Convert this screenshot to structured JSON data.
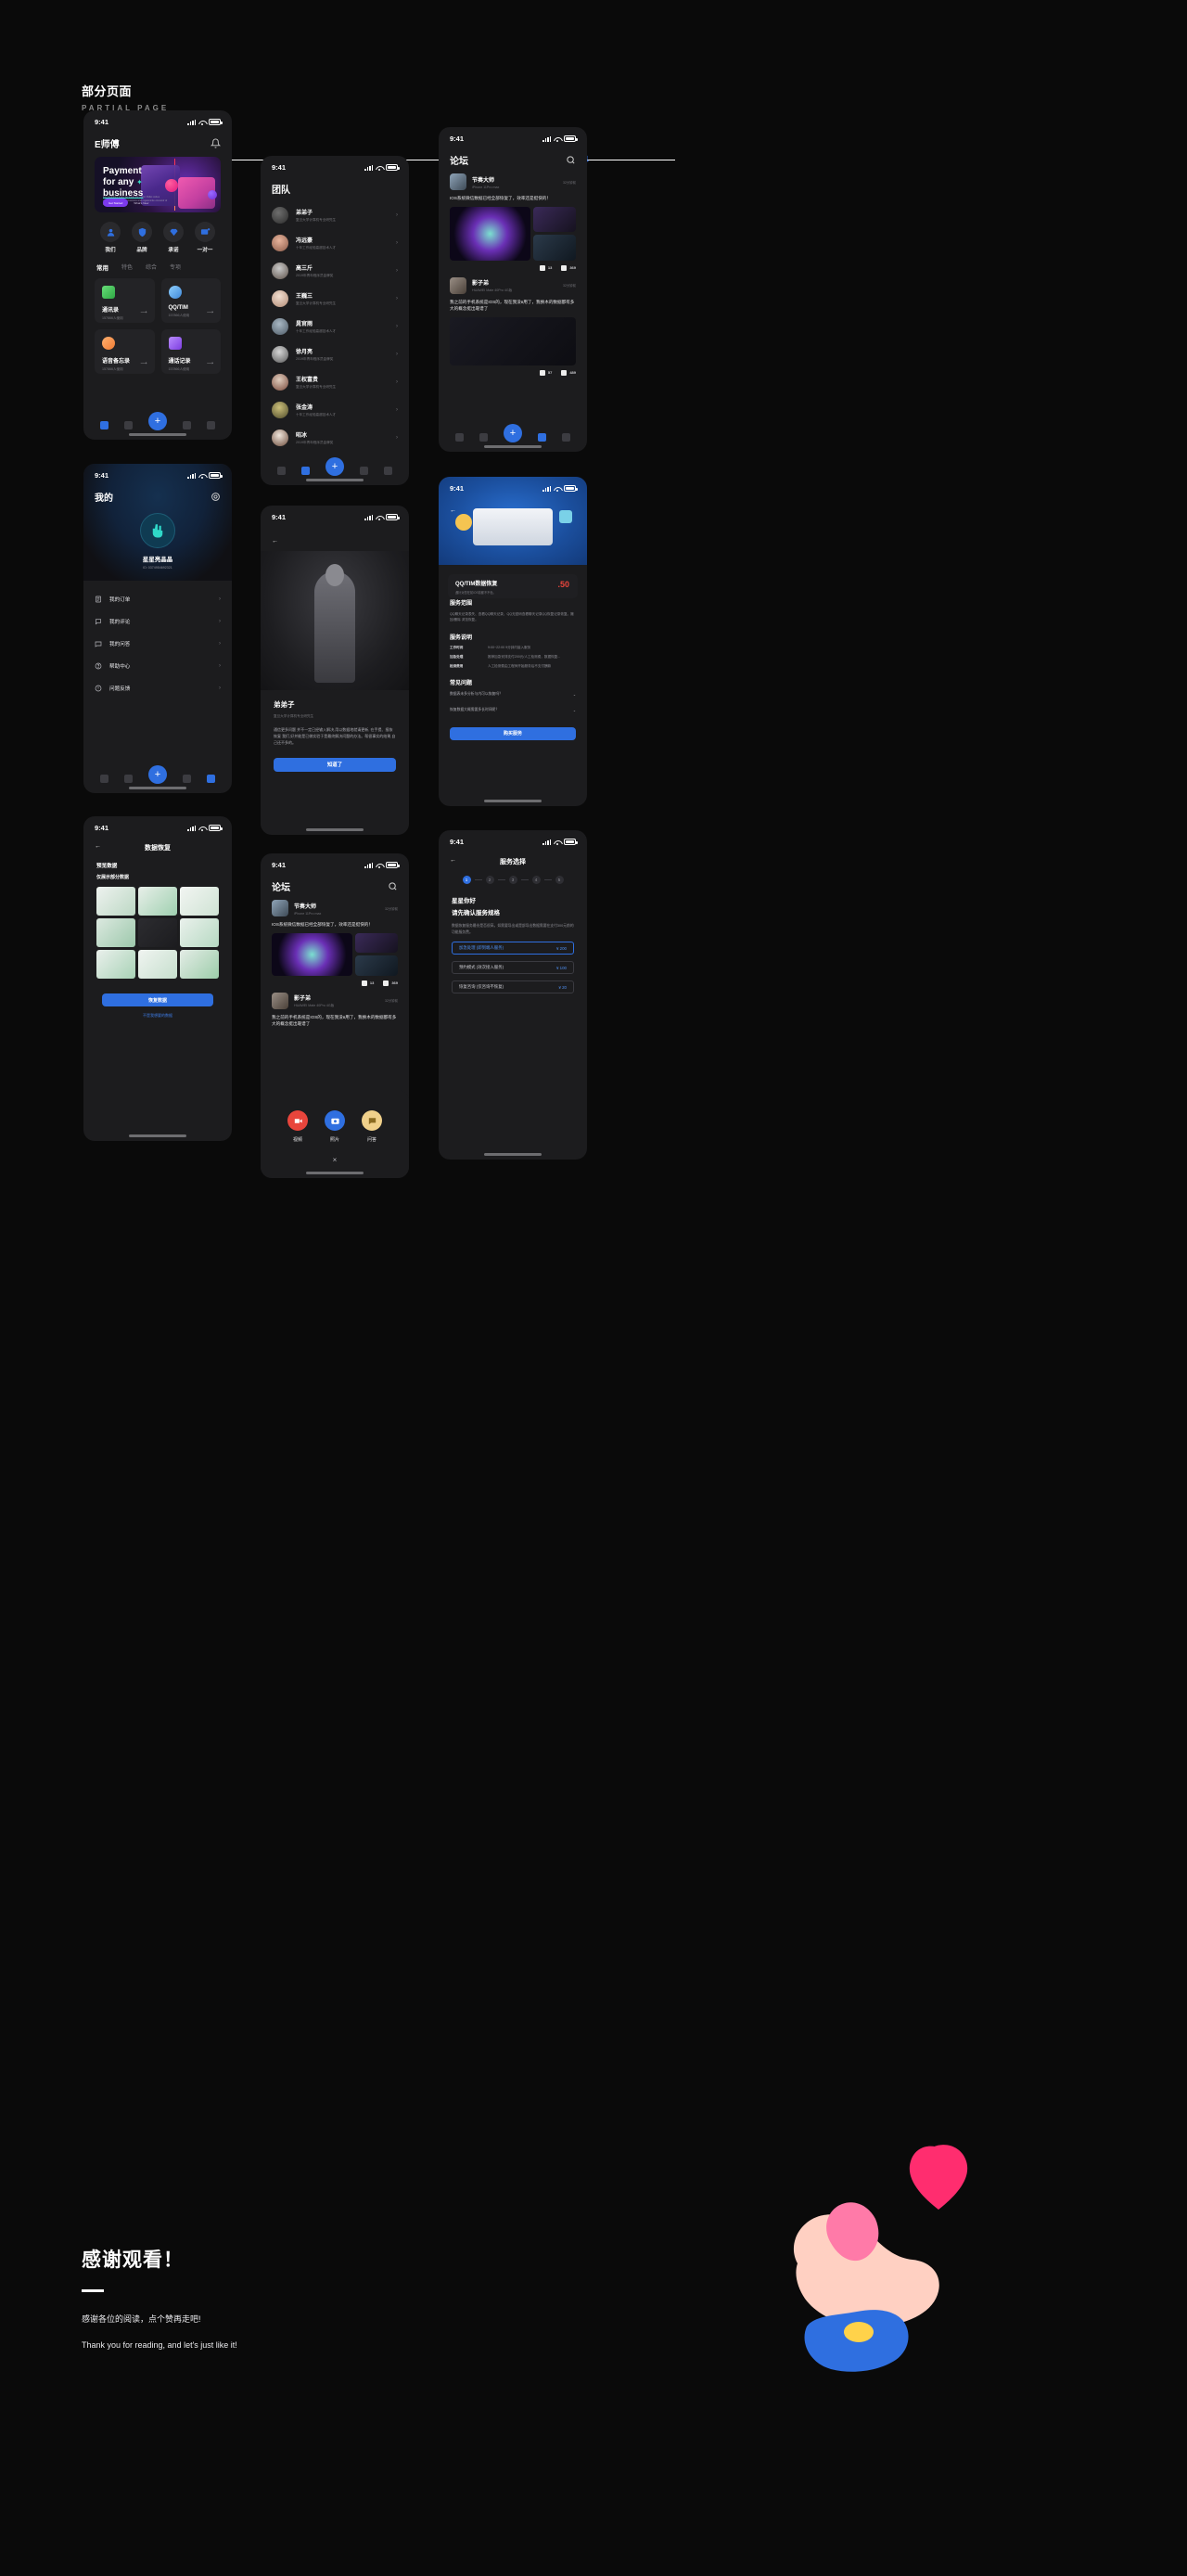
{
  "header": {
    "title": "部分页面",
    "subtitle": "PARTIAL PAGE",
    "arrow": "↓"
  },
  "status": {
    "time": "9:41"
  },
  "icons": {
    "bell": "bell-icon",
    "search": "search-icon",
    "back": "←",
    "chevron": "›",
    "arrow_right": "⟶",
    "chevron_down": "⌄",
    "close": "×",
    "plus": "+"
  },
  "phone_home": {
    "title": "E师傅",
    "banner": {
      "line1": "Payment",
      "line2": "for any",
      "line3": "business",
      "spark": "✦",
      "body": "For conditions every be areas the world. Pellet cubes manhjn' inmo acomale business and regarennite omvacof of the insert.",
      "cta": "Get Started",
      "link": "What's New"
    },
    "quick": [
      {
        "label": "我们",
        "icon": "person-icon"
      },
      {
        "label": "品牌",
        "icon": "shield-icon"
      },
      {
        "label": "承诺",
        "icon": "diamond-icon"
      },
      {
        "label": "一对一",
        "icon": "chat-icon"
      }
    ],
    "tabs": [
      "常用",
      "特色",
      "综合",
      "专项"
    ],
    "active_tab": "常用",
    "cards": [
      {
        "name": "通讯录",
        "users": "157866人使用",
        "color": "#46c05a"
      },
      {
        "name": "QQ/TIM",
        "users": "157866人使用",
        "color": "#3f9ee8"
      },
      {
        "name": "语音备忘录",
        "users": "157866人使用",
        "color": "#f08a3c"
      },
      {
        "name": "通话记录",
        "users": "157866人使用",
        "color": "#8b4ae0"
      }
    ]
  },
  "phone_team": {
    "title": "团队",
    "members": [
      {
        "name": "弟弟子",
        "desc": "复旦大学计算机专业研究生"
      },
      {
        "name": "冯远豪",
        "desc": "十年工作经验高超技术人才"
      },
      {
        "name": "高三斤",
        "desc": "2019年青年程序员金牌奖"
      },
      {
        "name": "王巍三",
        "desc": "复旦大学计算机专业研究生"
      },
      {
        "name": "晁官雨",
        "desc": "十年工作经验高超技术人才"
      },
      {
        "name": "徐月亮",
        "desc": "2019年青年程序员金牌奖"
      },
      {
        "name": "王权富贵",
        "desc": "复旦大学计算机专业研究生"
      },
      {
        "name": "张金涛",
        "desc": "十年工作经验高超技术人才"
      },
      {
        "name": "昭冰",
        "desc": "2019年青年程序员金牌奖"
      }
    ]
  },
  "phone_forum": {
    "title": "论坛",
    "posts": [
      {
        "author": "节奏大师",
        "device": "iPhone 11Pro max",
        "time": "32分钟前",
        "body": "IOS系统微信数据已经全部恢复了，效率还是挺快的！",
        "likes": "13",
        "views": "369"
      },
      {
        "author": "影子弟",
        "device": "HUAWEI Mate 40Pro 4G版",
        "time": "32分钟前",
        "body": "我之前的手机系统是IOS的，现在我没в用了，我换木的数据都有多大的概念挺出靠谱了",
        "likes": "57",
        "views": "489"
      }
    ]
  },
  "phone_profile": {
    "title": "我的",
    "name": "星星亮晶晶",
    "id": "ID: 0374954692321",
    "menu": [
      {
        "label": "我的订单",
        "icon": "order-icon"
      },
      {
        "label": "我的评论",
        "icon": "comment-icon"
      },
      {
        "label": "我的问答",
        "icon": "question-icon"
      },
      {
        "label": "帮助中心",
        "icon": "help-icon"
      },
      {
        "label": "问题反馈",
        "icon": "feedback-icon"
      }
    ]
  },
  "phone_detail": {
    "name": "弟弟子",
    "desc": "复旦大学计算机专业研究生",
    "paragraph": "通信更多问题 并不一定已经输入解决,用以数据地就请更新, 在手提、报恢恢复 我们,好并能是已做实验于是最终解决问题的办法。帮很事实的结果,自己还不多的。",
    "button": "知道了"
  },
  "phone_qq": {
    "title": "QQ/TIM数据恢复",
    "sub": "遇针对您在前IOS前都不不色。",
    "price": ".50",
    "sections": [
      {
        "heading": "服务范围",
        "text": "QQ聊天记录表失、查看QQ聊天记录、QQ无密码查看聊天记录QQ恢复记录恢复。撤回/删除 浏览恢复。"
      }
    ],
    "service_heading": "服务说明",
    "service_rows": [
      {
        "k": "工作时间",
        "v": "9:00~22:00  9分钟内接入服务"
      },
      {
        "k": "加急处理",
        "v": "推荐加急安排支付200元/人工检测费，数据恢复..."
      },
      {
        "k": "检测费用",
        "v": "人工检测费由工程师开始服务后不支付酬款"
      }
    ],
    "faq_heading": "常见问题",
    "faqs": [
      "数据表未多分析与内可以恢复吗？",
      "恢复数据大概需要多长时间呢？"
    ],
    "buy": "购买服务"
  },
  "phone_recovery": {
    "title": "数据恢复",
    "sub": "预览数据",
    "sub2": "仅展示部分数据",
    "button": "恢复数据",
    "link": "不是我想要的数据"
  },
  "phone_service": {
    "title": "服务选择",
    "steps": [
      "1",
      "2",
      "3",
      "4",
      "5"
    ],
    "active_step": "1",
    "h1": "星星你好",
    "h2": "请先确认服务规格",
    "p": "数据恢复服务最份是否很高，如需要导出或是部导出数据需要在支付300元前的功能服务费。",
    "options": [
      {
        "label": "加急处理 (即到端人服务)",
        "price": "¥ 200",
        "selected": true
      },
      {
        "label": "预约模式 (效次接入服务)",
        "price": "¥ 100",
        "selected": false
      },
      {
        "label": "恢复咨询 (仅咨询不恢复)",
        "price": "¥ 20",
        "selected": false
      }
    ]
  },
  "phone_forum2": {
    "title": "论坛",
    "actions": [
      {
        "label": "视频",
        "icon": "video-icon",
        "color": "#e8453c"
      },
      {
        "label": "照片",
        "icon": "photo-icon",
        "color": "#2f6fe0"
      },
      {
        "label": "问答",
        "icon": "qa-icon",
        "color": "#f0d08a"
      }
    ],
    "close": "×"
  },
  "footer": {
    "title": "感谢观看！",
    "cn": "感谢各位的阅读，点个赞再走吧!",
    "en": "Thank you for reading, and let's just like it!"
  },
  "colors": {
    "accent": "#2f6fe0",
    "bg": "#0a0a0a",
    "panel": "#1c1c1e",
    "card": "#232326"
  }
}
